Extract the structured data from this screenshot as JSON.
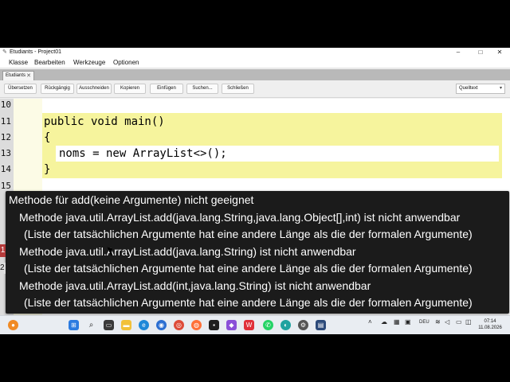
{
  "window": {
    "title": "Etudiants - Project01",
    "minimize": "–",
    "maximize": "□",
    "close": "✕"
  },
  "menu": [
    "Klasse",
    "Bearbeiten",
    "Werkzeuge",
    "Optionen"
  ],
  "tab": {
    "label": "Etudiants",
    "close": "✕"
  },
  "toolbar": {
    "buttons": [
      "Übersetzen",
      "Rückgängig",
      "Ausschneiden",
      "Kopieren",
      "Einfügen",
      "Suchen...",
      "Schließen"
    ],
    "view_select": "Quelltext"
  },
  "editor": {
    "line_numbers": [
      "10",
      "11",
      "12",
      "13",
      "14",
      "15"
    ],
    "code_lines": [
      "public void main()",
      "{",
      "noms = new ArrayList<>();",
      "}"
    ]
  },
  "error": {
    "lines": [
      "Methode für add(keine Argumente) nicht geeignet",
      "Methode java.util.ArrayList.add(java.lang.String,java.lang.Object[],int) ist nicht anwendbar",
      "(Liste der tatsächlichen Argumente hat eine andere Länge als die der formalen Argumente)",
      "Methode java.util.ArrayList.add(java.lang.String) ist nicht anwendbar",
      "(Liste der tatsächlichen Argumente hat eine andere Länge als die der formalen Argumente)",
      "Methode java.util.ArrayList.add(int,java.lang.String) ist nicht anwendbar",
      "(Liste der tatsächlichen Argumente hat eine andere Länge als die der formalen Argumente)"
    ],
    "gutter_marker": "1",
    "gutter_marker2": "2"
  },
  "taskbar": {
    "tray_lang": "DEU",
    "clock_time": "07:14",
    "clock_date": "11.08.2026"
  },
  "colors": {
    "method_highlight": "#f6f49d",
    "error_background": "#1b1b1b",
    "gutter": "#dcdcdc"
  }
}
